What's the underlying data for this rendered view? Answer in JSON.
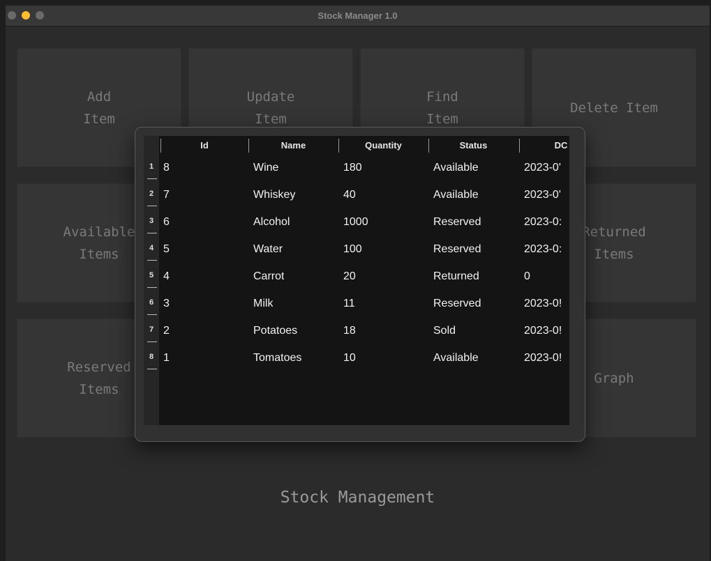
{
  "window": {
    "title": "Stock Manager 1.0"
  },
  "tiles": {
    "add": {
      "line1": "Add",
      "line2": "Item"
    },
    "update": {
      "line1": "Update",
      "line2": "Item"
    },
    "find": {
      "line1": "Find",
      "line2": "Item"
    },
    "delete": {
      "line1": "Delete Item"
    },
    "available": {
      "line1": "Available",
      "line2": "Items"
    },
    "returned": {
      "line1": "Returned",
      "line2": "Items"
    },
    "reserved": {
      "line1": "Reserved",
      "line2": "Items"
    },
    "graph": {
      "line1": "Graph"
    }
  },
  "footer": {
    "text": "Stock Management"
  },
  "table": {
    "headers": {
      "id": "Id",
      "name": "Name",
      "quantity": "Quantity",
      "status": "Status",
      "date": "DC"
    },
    "rows": [
      {
        "num": "1",
        "id": "8",
        "name": "Wine",
        "quantity": "180",
        "status": "Available",
        "date": "2023-0'"
      },
      {
        "num": "2",
        "id": "7",
        "name": "Whiskey",
        "quantity": "40",
        "status": "Available",
        "date": "2023-0'"
      },
      {
        "num": "3",
        "id": "6",
        "name": "Alcohol",
        "quantity": "1000",
        "status": "Reserved",
        "date": "2023-0:"
      },
      {
        "num": "4",
        "id": "5",
        "name": "Water",
        "quantity": "100",
        "status": "Reserved",
        "date": "2023-0:"
      },
      {
        "num": "5",
        "id": "4",
        "name": "Carrot",
        "quantity": "20",
        "status": "Returned",
        "date": "0"
      },
      {
        "num": "6",
        "id": "3",
        "name": "Milk",
        "quantity": "11",
        "status": "Reserved",
        "date": "2023-0!"
      },
      {
        "num": "7",
        "id": "2",
        "name": "Potatoes",
        "quantity": "18",
        "status": "Sold",
        "date": "2023-0!"
      },
      {
        "num": "8",
        "id": "1",
        "name": "Tomatoes",
        "quantity": "10",
        "status": "Available",
        "date": "2023-0!"
      }
    ]
  },
  "colors": {
    "minimize": "#febc2e",
    "background": "#2b2b2b",
    "tile": "#353535"
  }
}
